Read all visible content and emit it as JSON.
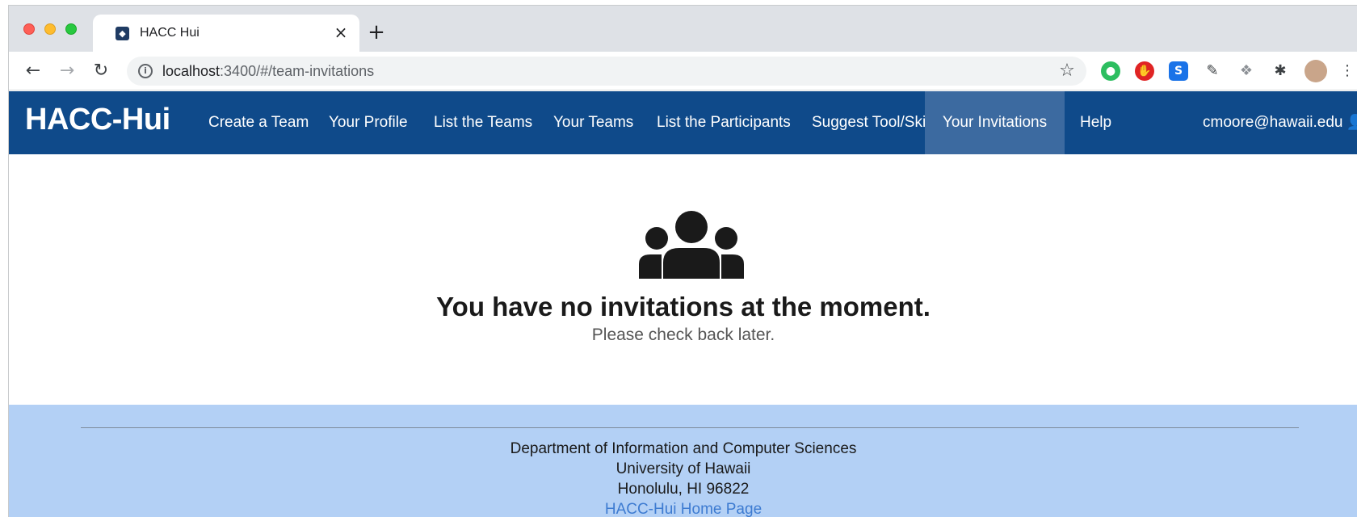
{
  "browser": {
    "tab_title": "HACC Hui",
    "tab_close": "×",
    "new_tab": "+",
    "url_host": "localhost",
    "url_rest": ":3400/#/team-invitations"
  },
  "navbar": {
    "brand": "HACC-Hui",
    "items": [
      {
        "label": "Create a Team"
      },
      {
        "label": "Your Profile"
      },
      {
        "label": "List the Teams"
      },
      {
        "label": "Your Teams"
      },
      {
        "label": "List the Participants"
      },
      {
        "label": "Suggest Tool/Skill"
      },
      {
        "label": "Your Invitations",
        "active": true
      },
      {
        "label": "Help"
      }
    ],
    "user": "cmoore@hawaii.edu"
  },
  "main": {
    "title": "You have no invitations at the moment.",
    "subtitle": "Please check back later."
  },
  "footer": {
    "line1": "Department of Information and Computer Sciences",
    "line2": "University of Hawaii",
    "line3": "Honolulu, HI 96822",
    "link": "HACC-Hui Home Page"
  },
  "colors": {
    "navbar_bg": "#0f4a8a",
    "navbar_active": "#3c6aa0",
    "footer_bg": "#b3d0f5",
    "link": "#3d7bd1"
  }
}
